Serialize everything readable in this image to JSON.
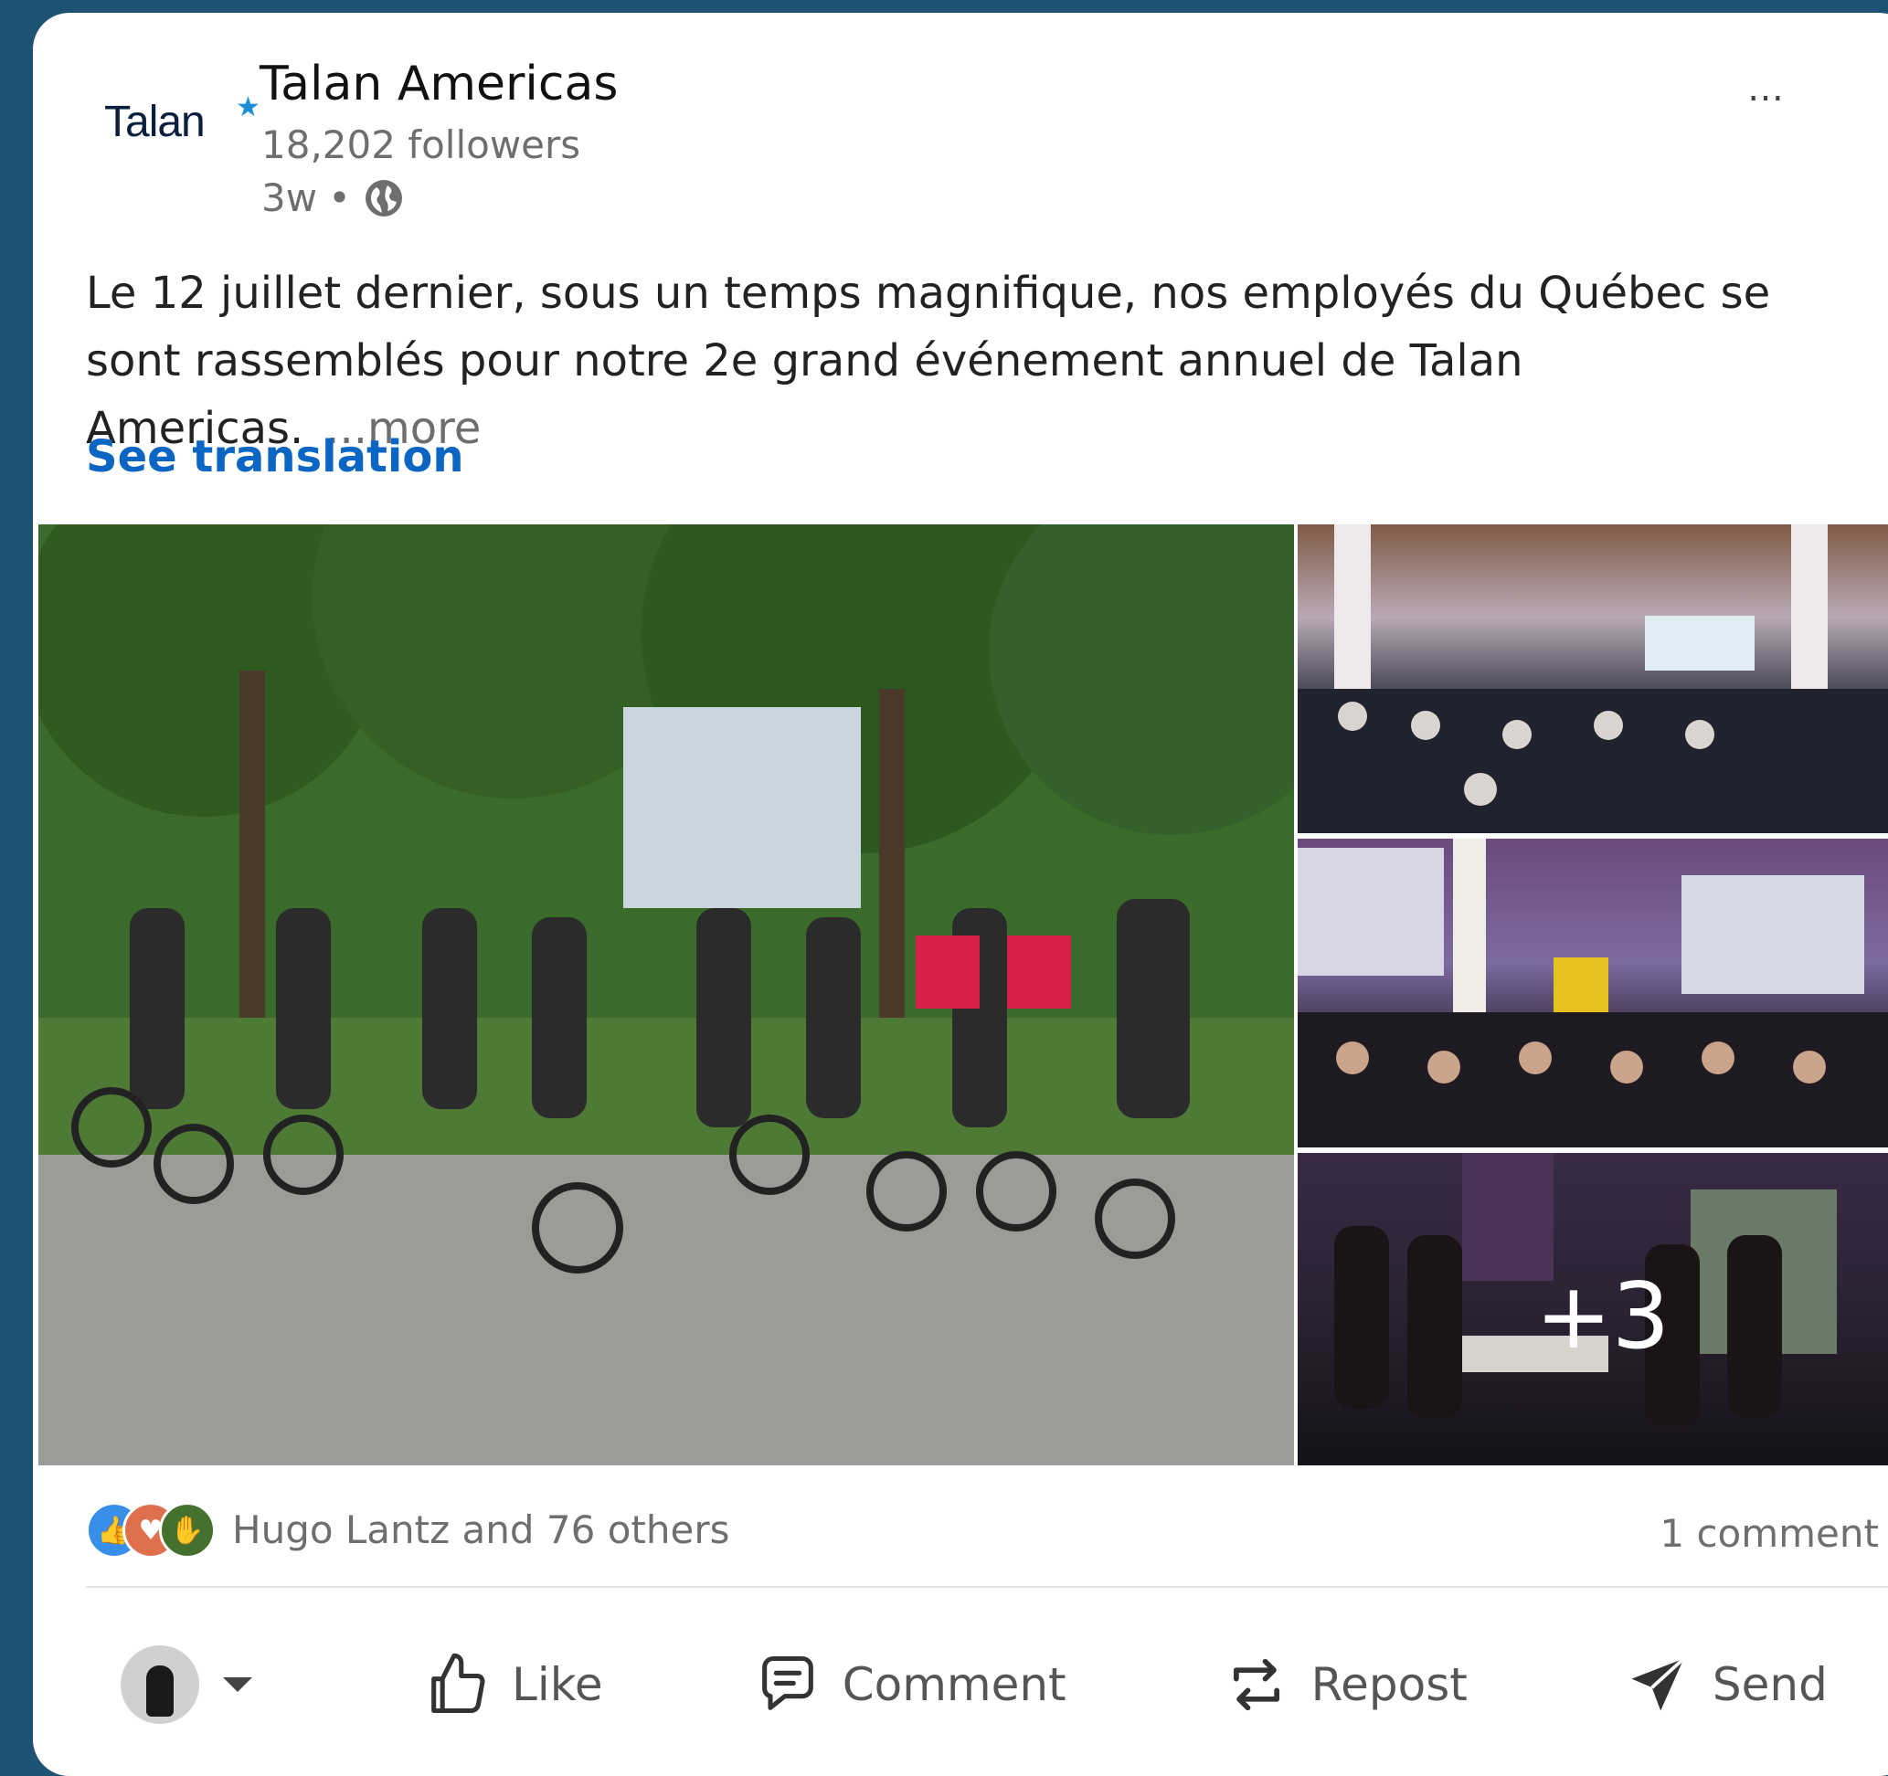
{
  "post": {
    "author": {
      "logo_text": "Talan",
      "name": "Talan Americas",
      "followers": "18,202 followers",
      "time": "3w",
      "separator": "•",
      "visibility_icon": "globe-icon"
    },
    "menu_icon": "…",
    "text": "Le 12 juillet dernier, sous un temps magnifique, nos employés du Québec se sont rassemblés pour notre 2e grand événement annuel de Talan Americas.",
    "more_label": "...more",
    "see_translation": "See translation",
    "images": {
      "more_count": "+3"
    },
    "reactions": {
      "icons": [
        "like-icon",
        "love-icon",
        "celebrate-icon"
      ],
      "summary": "Hugo Lantz and 76 others",
      "comments": "1 comment"
    },
    "actions": {
      "like": "Like",
      "comment": "Comment",
      "repost": "Repost",
      "send": "Send"
    }
  },
  "colors": {
    "background": "#1e5272",
    "link": "#0a66c2",
    "muted": "#6e6e6e"
  }
}
